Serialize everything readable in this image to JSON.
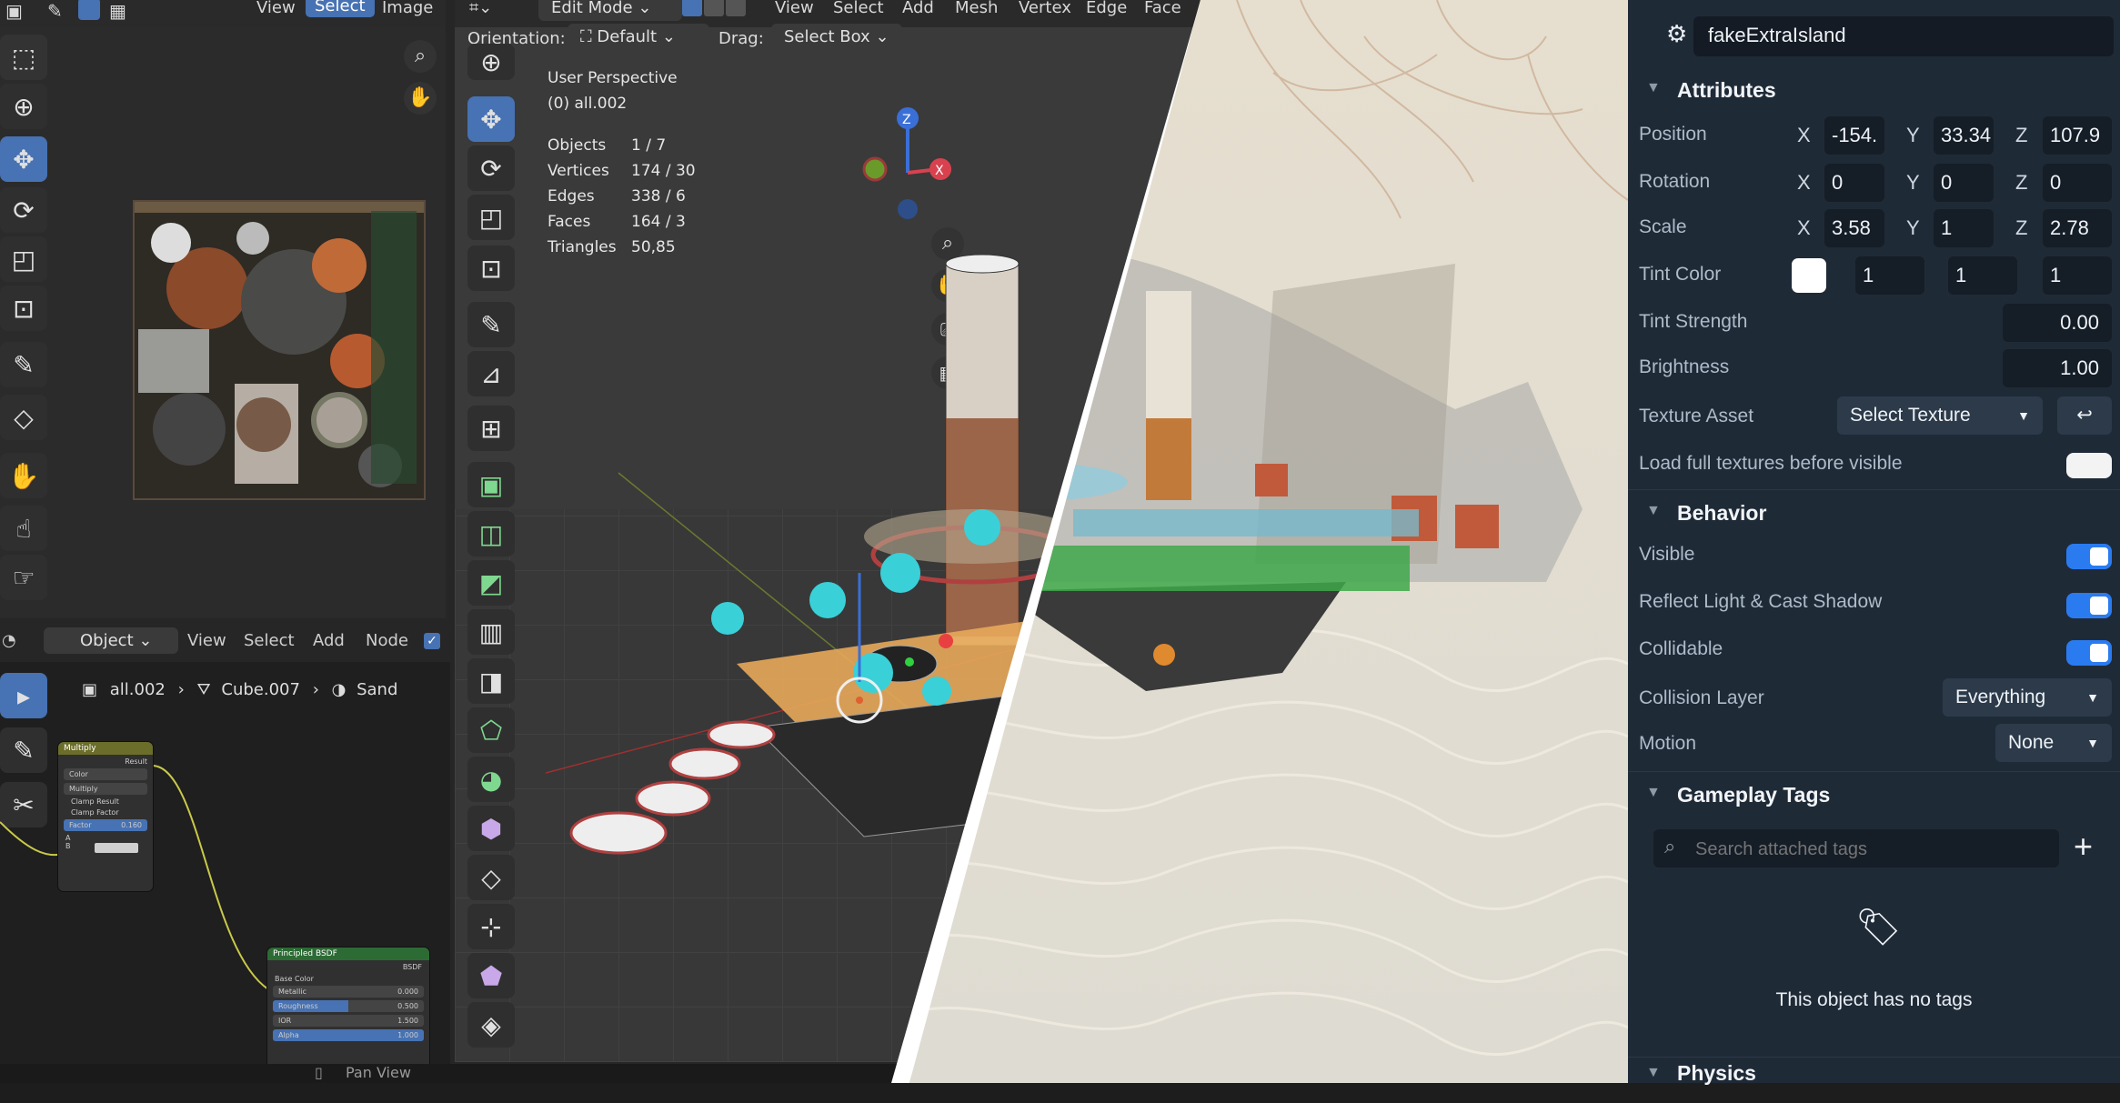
{
  "blender": {
    "top_menu": {
      "view": "View",
      "select": "Select",
      "image": "Image",
      "view2": "View",
      "select2": "Select",
      "add": "Add",
      "mesh": "Mesh",
      "vertex": "Vertex",
      "edge": "Edge",
      "face": "Face"
    },
    "mode_select": "Edit Mode",
    "orientation_label": "Orientation:",
    "orientation_value": "Default",
    "drag_label": "Drag:",
    "drag_value": "Select Box",
    "viewport_overlay": {
      "perspective": "User Perspective",
      "collection": "(0) all.002",
      "stats": [
        {
          "label": "Objects",
          "value": "1 / 7"
        },
        {
          "label": "Vertices",
          "value": "174 / 30"
        },
        {
          "label": "Edges",
          "value": "338 / 6"
        },
        {
          "label": "Faces",
          "value": "164 / 3"
        },
        {
          "label": "Triangles",
          "value": "50,85"
        }
      ]
    },
    "node_editor": {
      "object_select": "Object",
      "menus": {
        "view": "View",
        "select": "Select",
        "add": "Add",
        "node": "Node"
      },
      "breadcrumb": [
        "all.002",
        "Cube.007",
        "Sand"
      ],
      "mix_node": {
        "title": "Multiply",
        "output": "Result",
        "type": "Color",
        "blend": "Multiply",
        "clamp_result": "Clamp Result",
        "clamp_factor": "Clamp Factor",
        "factor_label": "Factor",
        "factor_value": "0.160",
        "input_a": "A",
        "input_b": "B"
      },
      "bsdf_node": {
        "title": "Principled BSDF",
        "output": "BSDF",
        "base_color": "Base Color",
        "metallic": "Metallic",
        "metallic_value": "0.000",
        "roughness": "Roughness",
        "roughness_value": "0.500",
        "ior": "IOR",
        "ior_value": "1.500",
        "alpha": "Alpha",
        "alpha_value": "1.000"
      }
    },
    "status_bar": {
      "pan_view": "Pan View"
    }
  },
  "panel": {
    "object_name": "fakeExtraIsland",
    "sections": {
      "attributes": "Attributes",
      "behavior": "Behavior",
      "gameplay_tags": "Gameplay Tags",
      "physics": "Physics"
    },
    "position": {
      "label": "Position",
      "x": "-154.",
      "y": "33.34",
      "z": "107.9"
    },
    "rotation": {
      "label": "Rotation",
      "x": "0",
      "y": "0",
      "z": "0"
    },
    "scale": {
      "label": "Scale",
      "x": "3.58",
      "y": "1",
      "z": "2.78"
    },
    "axes": {
      "x": "X",
      "y": "Y",
      "z": "Z"
    },
    "tint_color": {
      "label": "Tint Color",
      "swatch": "#ffffff",
      "r": "1",
      "g": "1",
      "b": "1"
    },
    "tint_strength": {
      "label": "Tint Strength",
      "value": "0.00"
    },
    "brightness": {
      "label": "Brightness",
      "value": "1.00"
    },
    "texture_asset": {
      "label": "Texture Asset",
      "value": "Select Texture"
    },
    "load_full_textures": {
      "label": "Load full textures before visible",
      "on": false
    },
    "visible": {
      "label": "Visible",
      "on": true
    },
    "reflect_light": {
      "label": "Reflect Light & Cast Shadow",
      "on": true
    },
    "collidable": {
      "label": "Collidable",
      "on": true
    },
    "collision_layer": {
      "label": "Collision Layer",
      "value": "Everything"
    },
    "motion": {
      "label": "Motion",
      "value": "None"
    },
    "tags": {
      "search_placeholder": "Search attached tags",
      "empty_message": "This object has no tags"
    },
    "colors": {
      "panel_bg": "#1f2a37",
      "accent": "#2b7bf0"
    }
  }
}
